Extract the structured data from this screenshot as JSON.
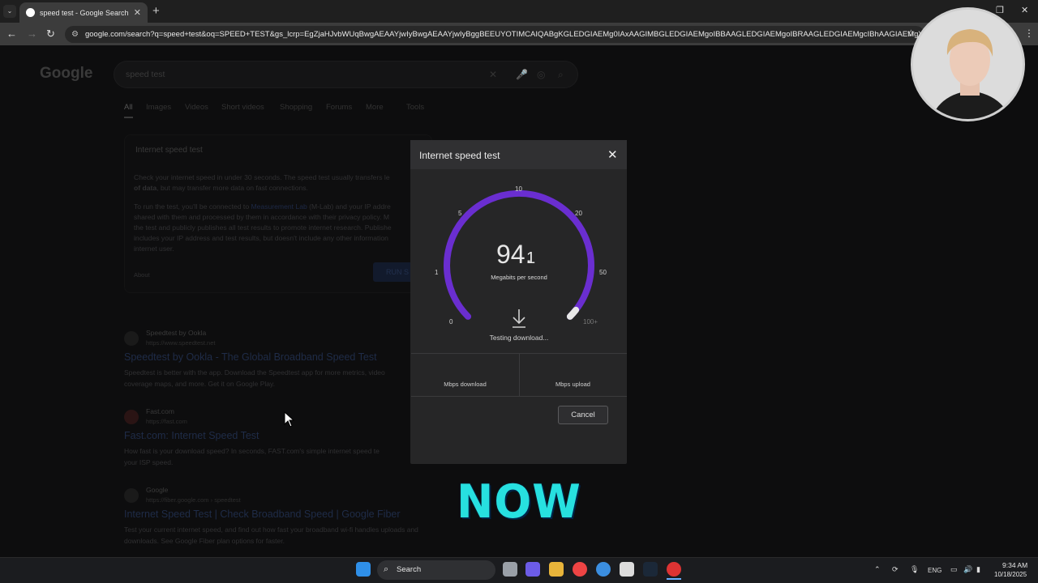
{
  "browser": {
    "tab_title": "speed test - Google Search",
    "url": "google.com/search?q=speed+test&oq=SPEED+TEST&gs_lcrp=EgZjaHJvbWUqBwgAEAAYjwIyBwgAEAAYjwIyBggBEEUYOTIMCAIQABgKGLEDGIAEMg0IAxAAGIMBGLEDGIAEMgoIBBAAGLEDGIAEMgoIBRAAGLEDGIAEMgcIBhAAGIAEMgYIBxAFGED..."
  },
  "google": {
    "logo": "Google",
    "query": "speed test",
    "tabs": [
      "All",
      "Images",
      "Videos",
      "Short videos",
      "Shopping",
      "Forums",
      "More",
      "Tools"
    ],
    "card_title": "Internet speed test",
    "card_p1a": "Check your internet speed in under 30 seconds. The speed test usually transfers le",
    "card_p1b": "of data",
    "card_p1c": ", but may transfer more data on fast connections.",
    "card_p2_l1a": "To run the test, you'll be connected to ",
    "card_p2_link": "Measurement Lab",
    "card_p2_l1b": " (M-Lab) and your IP addre",
    "card_p2_l2": "shared with them and processed by them in accordance with their privacy policy. M",
    "card_p2_l3": "the test and publicly publishes all test results to promote internet research. Publishe",
    "card_p2_l4": "includes your IP address and test results, but doesn't include any other information",
    "card_p2_l5": "internet user.",
    "about": "About",
    "run_btn": "RUN S"
  },
  "results": [
    {
      "site": "Speedtest by Ookla",
      "url": "https://www.speedtest.net",
      "title": "Speedtest by Ookla - The Global Broadband Speed Test",
      "snippet1": "Speedtest is better with the app. Download the Speedtest app for more metrics, video",
      "snippet2": "coverage maps, and more. Get it on Google Play."
    },
    {
      "site": "Fast.com",
      "url": "https://fast.com",
      "title": "Fast.com: Internet Speed Test",
      "snippet1": "How fast is your download speed? In seconds, FAST.com's simple internet speed te",
      "snippet2": "your ISP speed."
    },
    {
      "site": "Google",
      "url": "https://fiber.google.com › speedtest",
      "title": "Internet Speed Test | Check Broadband Speed | Google Fiber",
      "snippet1": "Test your current internet speed, and find out how fast your broadband wi-fi handles uploads and",
      "snippet2": "downloads. See Google Fiber plan options for faster."
    }
  ],
  "speedtest": {
    "title": "Internet speed test",
    "ticks": [
      "0",
      "1",
      "5",
      "10",
      "20",
      "50",
      "100+"
    ],
    "speed_int": "94.",
    "speed_dec": "1",
    "speed_value": 94.1,
    "unit": "Megabits per second",
    "status": "Testing download...",
    "download_label": "Mbps download",
    "upload_label": "Mbps upload",
    "cancel": "Cancel",
    "arc_color": "#6a2ed0"
  },
  "overlay": {
    "caption": "NOW",
    "caption_color": "#27e0e0"
  },
  "taskbar": {
    "search": "Search",
    "lang": "ENG",
    "time": "9:34 AM",
    "date": "10/18/2025"
  }
}
